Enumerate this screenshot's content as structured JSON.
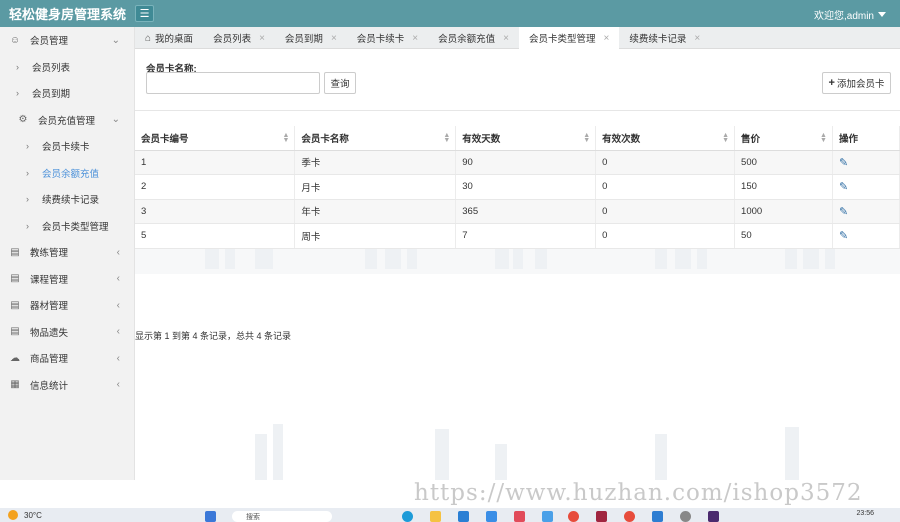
{
  "app": {
    "title": "轻松健身房管理系统",
    "welcome": "欢迎您,admin"
  },
  "sidebar": {
    "items": [
      {
        "label": "会员管理",
        "icon": "user-icon",
        "level": 0,
        "expanded": true
      },
      {
        "label": "会员列表",
        "icon": "chevron-right-icon",
        "level": 1
      },
      {
        "label": "会员到期",
        "icon": "chevron-right-icon",
        "level": 1
      },
      {
        "label": "会员充值管理",
        "icon": "settings-icon",
        "level": 1,
        "expanded": true
      },
      {
        "label": "会员卡续卡",
        "icon": "chevron-right-icon",
        "level": 2
      },
      {
        "label": "会员余额充值",
        "icon": "chevron-right-icon",
        "level": 2,
        "active": true
      },
      {
        "label": "续费续卡记录",
        "icon": "chevron-right-icon",
        "level": 2
      },
      {
        "label": "会员卡类型管理",
        "icon": "chevron-right-icon",
        "level": 2
      },
      {
        "label": "教练管理",
        "icon": "list-icon",
        "level": 0
      },
      {
        "label": "课程管理",
        "icon": "list-icon",
        "level": 0
      },
      {
        "label": "器材管理",
        "icon": "list-icon",
        "level": 0
      },
      {
        "label": "物品遗失",
        "icon": "list-icon",
        "level": 0
      },
      {
        "label": "商品管理",
        "icon": "cloud-icon",
        "level": 0
      },
      {
        "label": "信息统计",
        "icon": "grid-icon",
        "level": 0
      }
    ]
  },
  "tabs": [
    {
      "label": "我的桌面",
      "closable": false
    },
    {
      "label": "会员列表",
      "closable": true
    },
    {
      "label": "会员到期",
      "closable": true
    },
    {
      "label": "会员卡续卡",
      "closable": true
    },
    {
      "label": "会员余额充值",
      "closable": true
    },
    {
      "label": "会员卡类型管理",
      "closable": true,
      "active": true
    },
    {
      "label": "续费续卡记录",
      "closable": true
    }
  ],
  "search": {
    "label": "会员卡名称:",
    "value": "",
    "button": "查询"
  },
  "add_button": "添加会员卡",
  "table": {
    "columns": [
      "会员卡编号",
      "会员卡名称",
      "有效天数",
      "有效次数",
      "售价",
      "操作"
    ],
    "rows": [
      [
        "1",
        "季卡",
        "90",
        "0",
        "500"
      ],
      [
        "2",
        "月卡",
        "30",
        "0",
        "150"
      ],
      [
        "3",
        "年卡",
        "365",
        "0",
        "1000"
      ],
      [
        "5",
        "周卡",
        "7",
        "0",
        "50"
      ]
    ]
  },
  "summary": "显示第 1 到第 4 条记录，总共 4 条记录",
  "overlay_url": "https://www.huzhan.com/ishop3572",
  "taskbar": {
    "temperature": "30°C",
    "search_placeholder": "搜索",
    "time": "23:56"
  },
  "colors": {
    "header": "#5b9aa3",
    "active": "#4a90d9",
    "edit": "#2e6da4"
  }
}
